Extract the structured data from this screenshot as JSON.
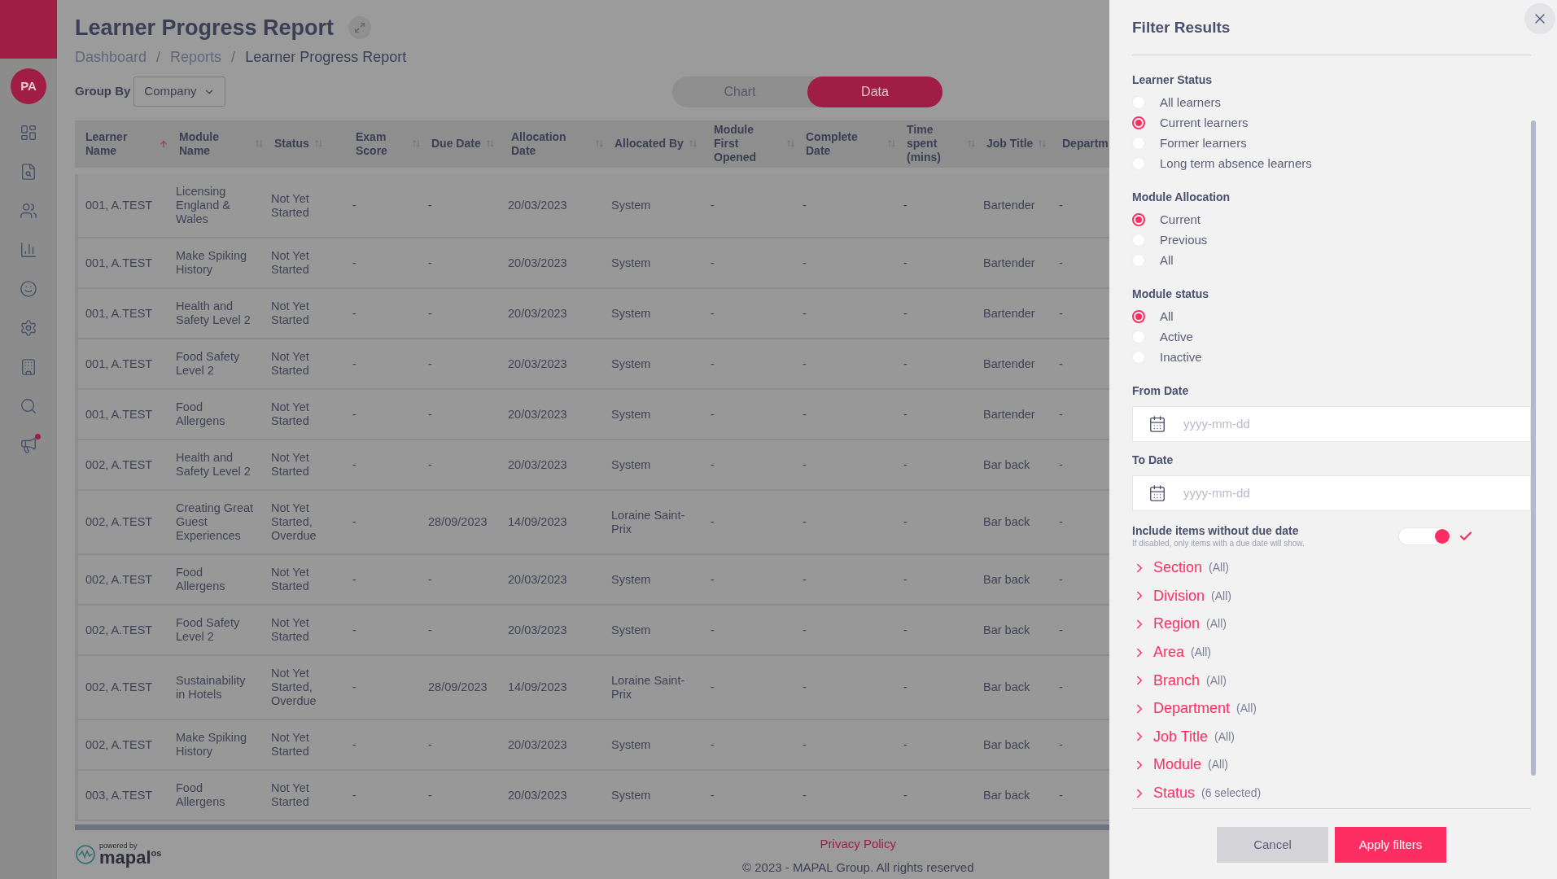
{
  "sidebar": {
    "avatar": "PA",
    "notification": true
  },
  "header": {
    "title": "Learner Progress Report",
    "breadcrumbs": [
      {
        "kind": "link",
        "label": "Dashboard"
      },
      {
        "kind": "separator",
        "label": "/"
      },
      {
        "kind": "link",
        "label": "Reports"
      },
      {
        "kind": "separator",
        "label": "/"
      },
      {
        "kind": "current",
        "label": "Learner Progress Report"
      }
    ]
  },
  "group_by": {
    "label": "Group By",
    "value": "Company"
  },
  "view_toggle": [
    {
      "label": "Chart",
      "selected": false
    },
    {
      "label": "Data",
      "selected": true
    }
  ],
  "table": {
    "columns": [
      {
        "label": "Learner Name",
        "sorted": true
      },
      {
        "label": "Module Name",
        "sorted": false
      },
      {
        "label": "Status",
        "sorted": false
      },
      {
        "label": "Exam Score",
        "sorted": false
      },
      {
        "label": "Due Date",
        "sorted": false
      },
      {
        "label": "Allocation Date",
        "sorted": false
      },
      {
        "label": "Allocated By",
        "sorted": false
      },
      {
        "label": "Module First Opened",
        "sorted": false
      },
      {
        "label": "Complete Date",
        "sorted": false
      },
      {
        "label": "Time spent (mins)",
        "sorted": false
      },
      {
        "label": "Job Title",
        "sorted": false
      },
      {
        "label": "Departm"
      }
    ],
    "rows": [
      [
        "001, A.TEST",
        "Licensing England & Wales",
        "Not Yet Started",
        "-",
        "-",
        "20/03/2023",
        "System",
        "-",
        "-",
        "-",
        "Bartender",
        "-"
      ],
      [
        "001, A.TEST",
        "Make Spiking History",
        "Not Yet Started",
        "-",
        "-",
        "20/03/2023",
        "System",
        "-",
        "-",
        "-",
        "Bartender",
        "-"
      ],
      [
        "001, A.TEST",
        "Health and Safety Level 2",
        "Not Yet Started",
        "-",
        "-",
        "20/03/2023",
        "System",
        "-",
        "-",
        "-",
        "Bartender",
        "-"
      ],
      [
        "001, A.TEST",
        "Food Safety Level 2",
        "Not Yet Started",
        "-",
        "-",
        "20/03/2023",
        "System",
        "-",
        "-",
        "-",
        "Bartender",
        "-"
      ],
      [
        "001, A.TEST",
        "Food Allergens",
        "Not Yet Started",
        "-",
        "-",
        "20/03/2023",
        "System",
        "-",
        "-",
        "-",
        "Bartender",
        "-"
      ],
      [
        "002, A.TEST",
        "Health and Safety Level 2",
        "Not Yet Started",
        "-",
        "-",
        "20/03/2023",
        "System",
        "-",
        "-",
        "-",
        "Bar back",
        "-"
      ],
      [
        "002, A.TEST",
        "Creating Great Guest Experiences",
        "Not Yet Started, Overdue",
        "-",
        "28/09/2023",
        "14/09/2023",
        "Loraine Saint-Prix",
        "-",
        "-",
        "-",
        "Bar back",
        "-"
      ],
      [
        "002, A.TEST",
        "Food Allergens",
        "Not Yet Started",
        "-",
        "-",
        "20/03/2023",
        "System",
        "-",
        "-",
        "-",
        "Bar back",
        "-"
      ],
      [
        "002, A.TEST",
        "Food Safety Level 2",
        "Not Yet Started",
        "-",
        "-",
        "20/03/2023",
        "System",
        "-",
        "-",
        "-",
        "Bar back",
        "-"
      ],
      [
        "002, A.TEST",
        "Sustainability in Hotels",
        "Not Yet Started, Overdue",
        "-",
        "28/09/2023",
        "14/09/2023",
        "Loraine Saint-Prix",
        "-",
        "-",
        "-",
        "Bar back",
        "-"
      ],
      [
        "002, A.TEST",
        "Make Spiking History",
        "Not Yet Started",
        "-",
        "-",
        "20/03/2023",
        "System",
        "-",
        "-",
        "-",
        "Bar back",
        "-"
      ],
      [
        "003, A.TEST",
        "Food Allergens",
        "Not Yet Started",
        "-",
        "-",
        "20/03/2023",
        "System",
        "-",
        "-",
        "-",
        "Bar back",
        "-"
      ]
    ]
  },
  "footer": {
    "powered_by": "powered by",
    "brand": "mapal",
    "brand_suffix": "os",
    "privacy_link": "Privacy Policy",
    "copyright": "© 2023 - MAPAL Group. All rights reserved"
  },
  "filter_panel": {
    "title": "Filter Results",
    "groups": [
      {
        "label": "Learner Status",
        "options": [
          {
            "label": "All learners",
            "selected": false
          },
          {
            "label": "Current learners",
            "selected": true
          },
          {
            "label": "Former learners",
            "selected": false
          },
          {
            "label": "Long term absence learners",
            "selected": false
          }
        ]
      },
      {
        "label": "Module Allocation",
        "options": [
          {
            "label": "Current",
            "selected": true
          },
          {
            "label": "Previous",
            "selected": false
          },
          {
            "label": "All",
            "selected": false
          }
        ]
      },
      {
        "label": "Module status",
        "options": [
          {
            "label": "All",
            "selected": true
          },
          {
            "label": "Active",
            "selected": false
          },
          {
            "label": "Inactive",
            "selected": false
          }
        ]
      }
    ],
    "date_fields": [
      {
        "label": "From Date",
        "placeholder": "yyyy-mm-dd"
      },
      {
        "label": "To Date",
        "placeholder": "yyyy-mm-dd"
      }
    ],
    "toggle": {
      "label": "Include items without due date",
      "hint": "If disabled, only items with a due date will show.",
      "on": true
    },
    "accordions": [
      {
        "label": "Section",
        "summary": "(All)",
        "expanded": false
      },
      {
        "label": "Division",
        "summary": "(All)",
        "expanded": false
      },
      {
        "label": "Region",
        "summary": "(All)",
        "expanded": false
      },
      {
        "label": "Area",
        "summary": "(All)",
        "expanded": false
      },
      {
        "label": "Branch",
        "summary": "(All)",
        "expanded": false
      },
      {
        "label": "Department",
        "summary": "(All)",
        "expanded": false
      },
      {
        "label": "Job Title",
        "summary": "(All)",
        "expanded": false
      },
      {
        "label": "Module",
        "summary": "(All)",
        "expanded": false
      },
      {
        "label": "Status",
        "summary": "(6 selected)",
        "expanded": false
      }
    ],
    "buttons": [
      {
        "label": "Cancel",
        "kind": "secondary"
      },
      {
        "label": "Apply filters",
        "kind": "primary"
      }
    ]
  }
}
